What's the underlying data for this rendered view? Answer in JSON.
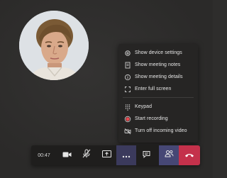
{
  "call": {
    "participant_avatar": "participant-photo"
  },
  "menu": {
    "items": [
      {
        "label": "Show device settings",
        "icon": "gear-icon"
      },
      {
        "label": "Show meeting notes",
        "icon": "notes-icon"
      },
      {
        "label": "Show meeting details",
        "icon": "info-icon"
      },
      {
        "label": "Enter full screen",
        "icon": "fullscreen-icon"
      },
      {
        "label": "Keypad",
        "icon": "keypad-icon"
      },
      {
        "label": "Start recording",
        "icon": "record-icon"
      },
      {
        "label": "Turn off incoming video",
        "icon": "video-off-icon"
      }
    ]
  },
  "toolbar": {
    "timer": "00:47",
    "buttons": [
      {
        "name": "camera-button",
        "icon": "camera-icon"
      },
      {
        "name": "mute-button",
        "icon": "mic-off-icon"
      },
      {
        "name": "share-button",
        "icon": "share-icon"
      },
      {
        "name": "more-actions-button",
        "icon": "more-icon"
      },
      {
        "name": "chat-button",
        "icon": "chat-icon"
      },
      {
        "name": "participants-button",
        "icon": "people-icon"
      },
      {
        "name": "hang-up-button",
        "icon": "phone-hangup-icon"
      }
    ]
  },
  "colors": {
    "background": "#2e2d2c",
    "menu_bg": "#262524",
    "toolbar_bg": "#1f1e1d",
    "accent": "#464775",
    "hangup": "#c4314b",
    "record": "#e8484f"
  }
}
